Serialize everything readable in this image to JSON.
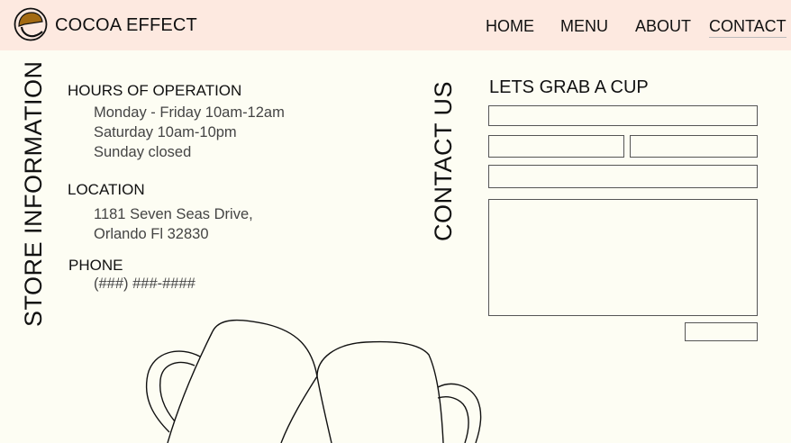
{
  "header": {
    "brand": "COCOA EFFECT",
    "logo_icon": "cocoa-swirl-logo-icon",
    "logo_color": "#a36a12",
    "nav": [
      {
        "label": "HOME"
      },
      {
        "label": "MENU"
      },
      {
        "label": "ABOUT"
      },
      {
        "label": "CONTACT",
        "active": true
      }
    ]
  },
  "store_info": {
    "heading": "STORE INFORMATION",
    "hours": {
      "label": "HOURS OF OPERATION",
      "lines": [
        "Monday - Friday 10am-12am",
        "Saturday 10am-10pm",
        "Sunday closed"
      ]
    },
    "location": {
      "label": "LOCATION",
      "lines": [
        "1181 Seven Seas Drive,",
        "Orlando Fl 32830"
      ]
    },
    "phone": {
      "label": "PHONE",
      "value": "(###) ###-####"
    }
  },
  "contact": {
    "heading": "CONTACT US",
    "form_title": "LETS GRAB A CUP",
    "fields": {
      "top": {
        "value": "",
        "placeholder": ""
      },
      "left": {
        "value": "",
        "placeholder": ""
      },
      "right": {
        "value": "",
        "placeholder": ""
      },
      "wide": {
        "value": "",
        "placeholder": ""
      },
      "message": {
        "value": "",
        "placeholder": ""
      }
    },
    "submit_label": ""
  },
  "illustration": {
    "icon": "clinking-mugs-icon"
  },
  "colors": {
    "header_bg": "#fde9e0",
    "page_bg": "#fdfdf3",
    "border": "#555555"
  }
}
